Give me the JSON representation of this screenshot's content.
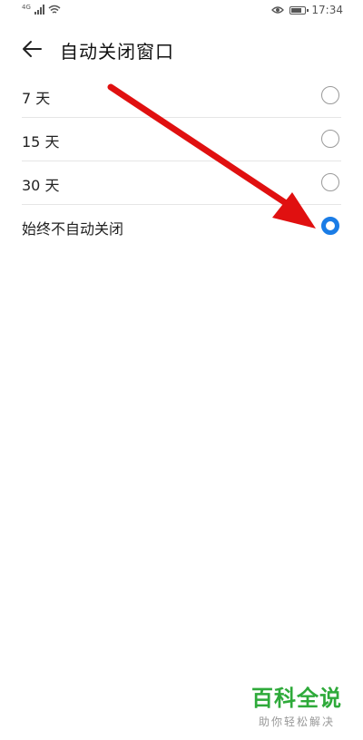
{
  "status_bar": {
    "network": "4G",
    "time": "17:34",
    "battery_level": 0.85
  },
  "header": {
    "title": "自动关闭窗口"
  },
  "options": [
    {
      "label": "7 天",
      "selected": false
    },
    {
      "label": "15 天",
      "selected": false
    },
    {
      "label": "30 天",
      "selected": false
    },
    {
      "label": "始终不自动关闭",
      "selected": true
    }
  ],
  "watermark": {
    "brand": "百科全说",
    "slogan": "助你轻松解决"
  },
  "colors": {
    "accent": "#1a7ce6",
    "annotation_arrow": "#e01010",
    "watermark_brand": "#2eaa3a"
  }
}
